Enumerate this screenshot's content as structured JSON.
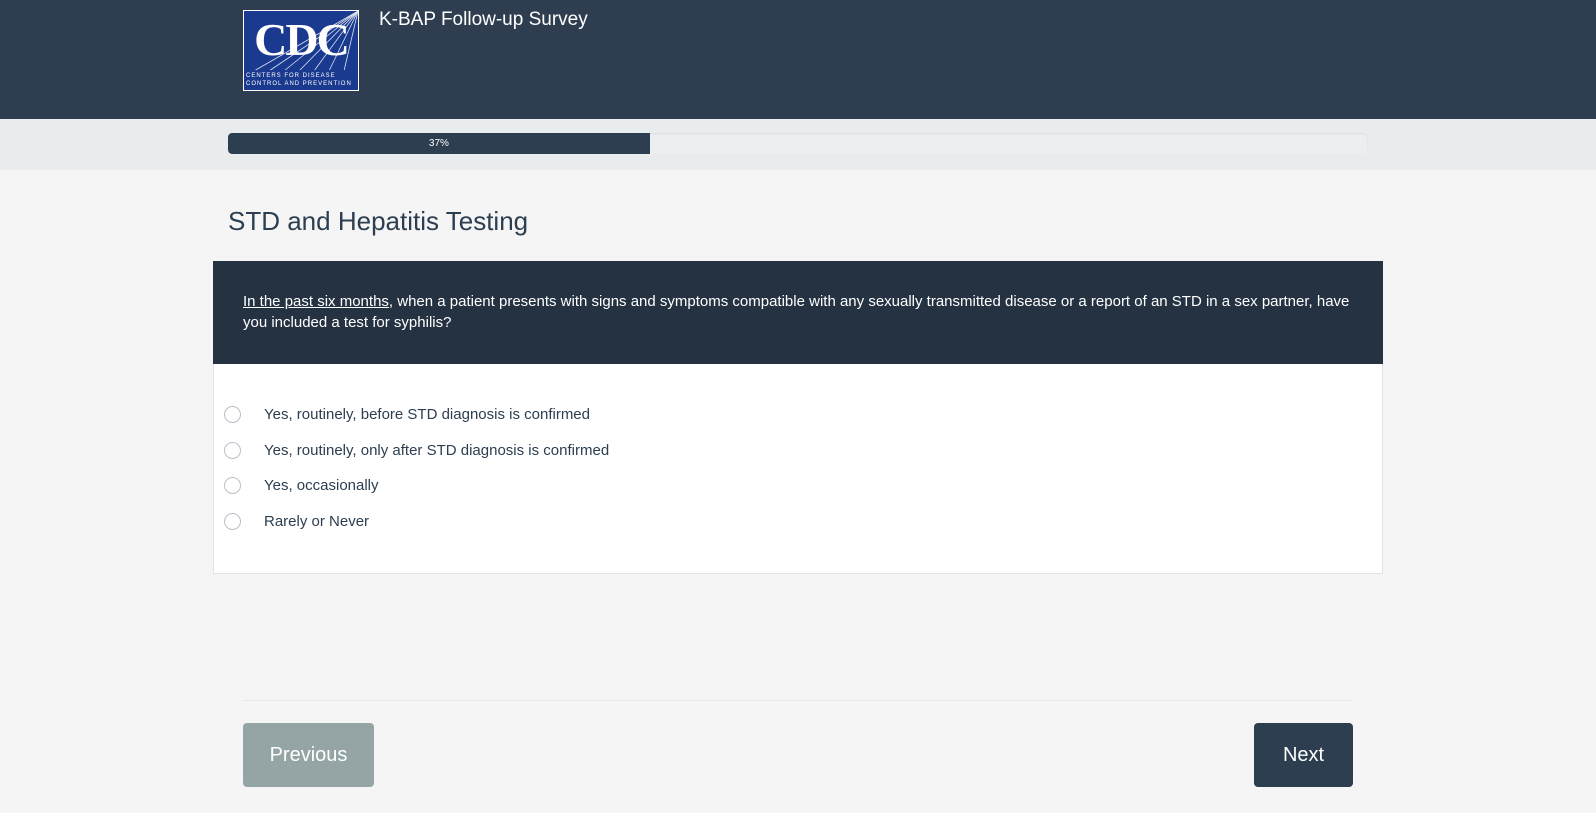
{
  "header": {
    "logo": {
      "icon": "cdc-logo",
      "text": "CDC",
      "subtext": "Centers for Disease Control and Prevention"
    },
    "title": "K-BAP Follow-up Survey"
  },
  "progress": {
    "percent": 37,
    "label": "37%"
  },
  "section": {
    "title": "STD and Hepatitis Testing"
  },
  "question": {
    "emphasis": "In the past six months",
    "text": ", when a patient presents with signs and symptoms compatible with any sexually transmitted disease or a report of an STD in a sex partner, have you included a test for syphilis?"
  },
  "options": [
    {
      "label": "Yes, routinely, before STD diagnosis is confirmed",
      "selected": false
    },
    {
      "label": "Yes, routinely, only after STD diagnosis is confirmed",
      "selected": false
    },
    {
      "label": "Yes, occasionally",
      "selected": false
    },
    {
      "label": "Rarely or Never",
      "selected": false
    }
  ],
  "nav": {
    "previous_label": "Previous",
    "next_label": "Next"
  },
  "colors": {
    "header_bg": "#2e3e50",
    "question_bg": "#243242",
    "primary": "#2c3e50",
    "previous_button": "#95a5a6",
    "page_bg": "#f5f5f5"
  }
}
